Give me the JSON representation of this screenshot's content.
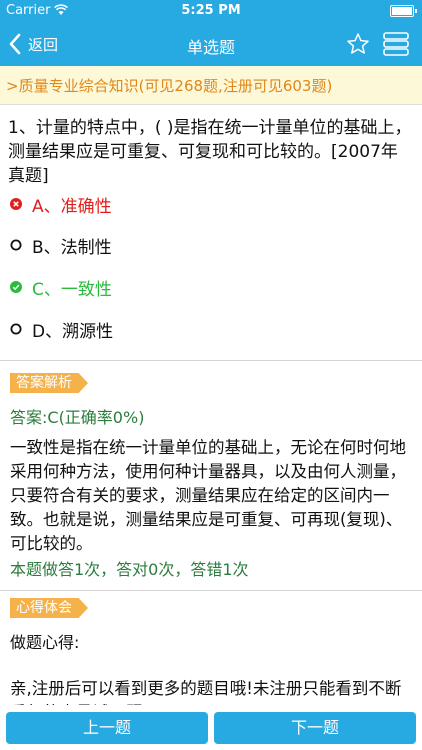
{
  "status_bar": {
    "carrier": "Carrier",
    "time": "5:25 PM"
  },
  "nav": {
    "back_label": "返回",
    "title": "单选题"
  },
  "category": ">质量专业综合知识(可见268题,注册可见603题)",
  "question": {
    "text": "1、计量的特点中，( )是指在统一计量单位的基础上，测量结果应是可重复、可复现和可比较的。[2007年真题]",
    "options": [
      {
        "label": "A、准确性",
        "state": "wrong",
        "color": "#e0201a"
      },
      {
        "label": "B、法制性",
        "state": "none",
        "color": "#111111"
      },
      {
        "label": "C、一致性",
        "state": "correct",
        "color": "#2bbb3c"
      },
      {
        "label": "D、溯源性",
        "state": "none",
        "color": "#111111"
      }
    ]
  },
  "analysis": {
    "tag": "答案解析",
    "answer": "答案:C(正确率0%)",
    "explanation": "一致性是指在统一计量单位的基础上，无论在何时何地采用何种方法，使用何种计量器具，以及由何人测量，只要符合有关的要求，测量结果应在给定的区间内一致。也就是说，测量结果应是可重复、可再现(复现)、可比较的。",
    "stats": "本题做答1次，答对0次，答错1次"
  },
  "notes": {
    "tag": "心得体会",
    "title": "做题心得:",
    "text": "亲,注册后可以看到更多的题目哦!未注册只能看到不断重复的少量试用题目!"
  },
  "footer": {
    "prev_label": "上一题",
    "next_label": "下一题"
  },
  "colors": {
    "accent": "#27a9e1",
    "tag": "#f6b24a",
    "category_bg": "#fdf9d8",
    "category_text": "#e0871a",
    "answer_green": "#2b7d3d"
  }
}
